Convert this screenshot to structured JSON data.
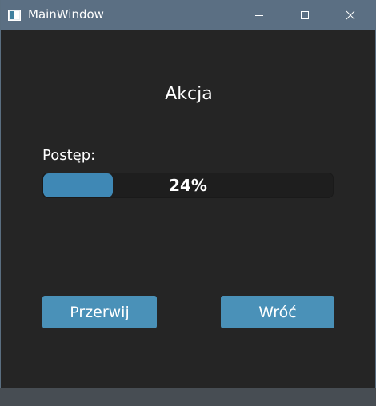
{
  "window": {
    "title": "MainWindow",
    "icon": "app-window-icon"
  },
  "controls": {
    "minimize_icon": "minimize-icon",
    "maximize_icon": "maximize-icon",
    "close_icon": "close-icon"
  },
  "main": {
    "heading": "Akcja",
    "progress_label": "Postęp:",
    "progress_percent": 24,
    "progress_text": "24%",
    "abort_label": "Przerwij",
    "back_label": "Wróć"
  },
  "colors": {
    "titlebar": "#5b6f83",
    "background": "#252525",
    "progress_fill": "#3f88b5",
    "button": "#4a91b8"
  }
}
